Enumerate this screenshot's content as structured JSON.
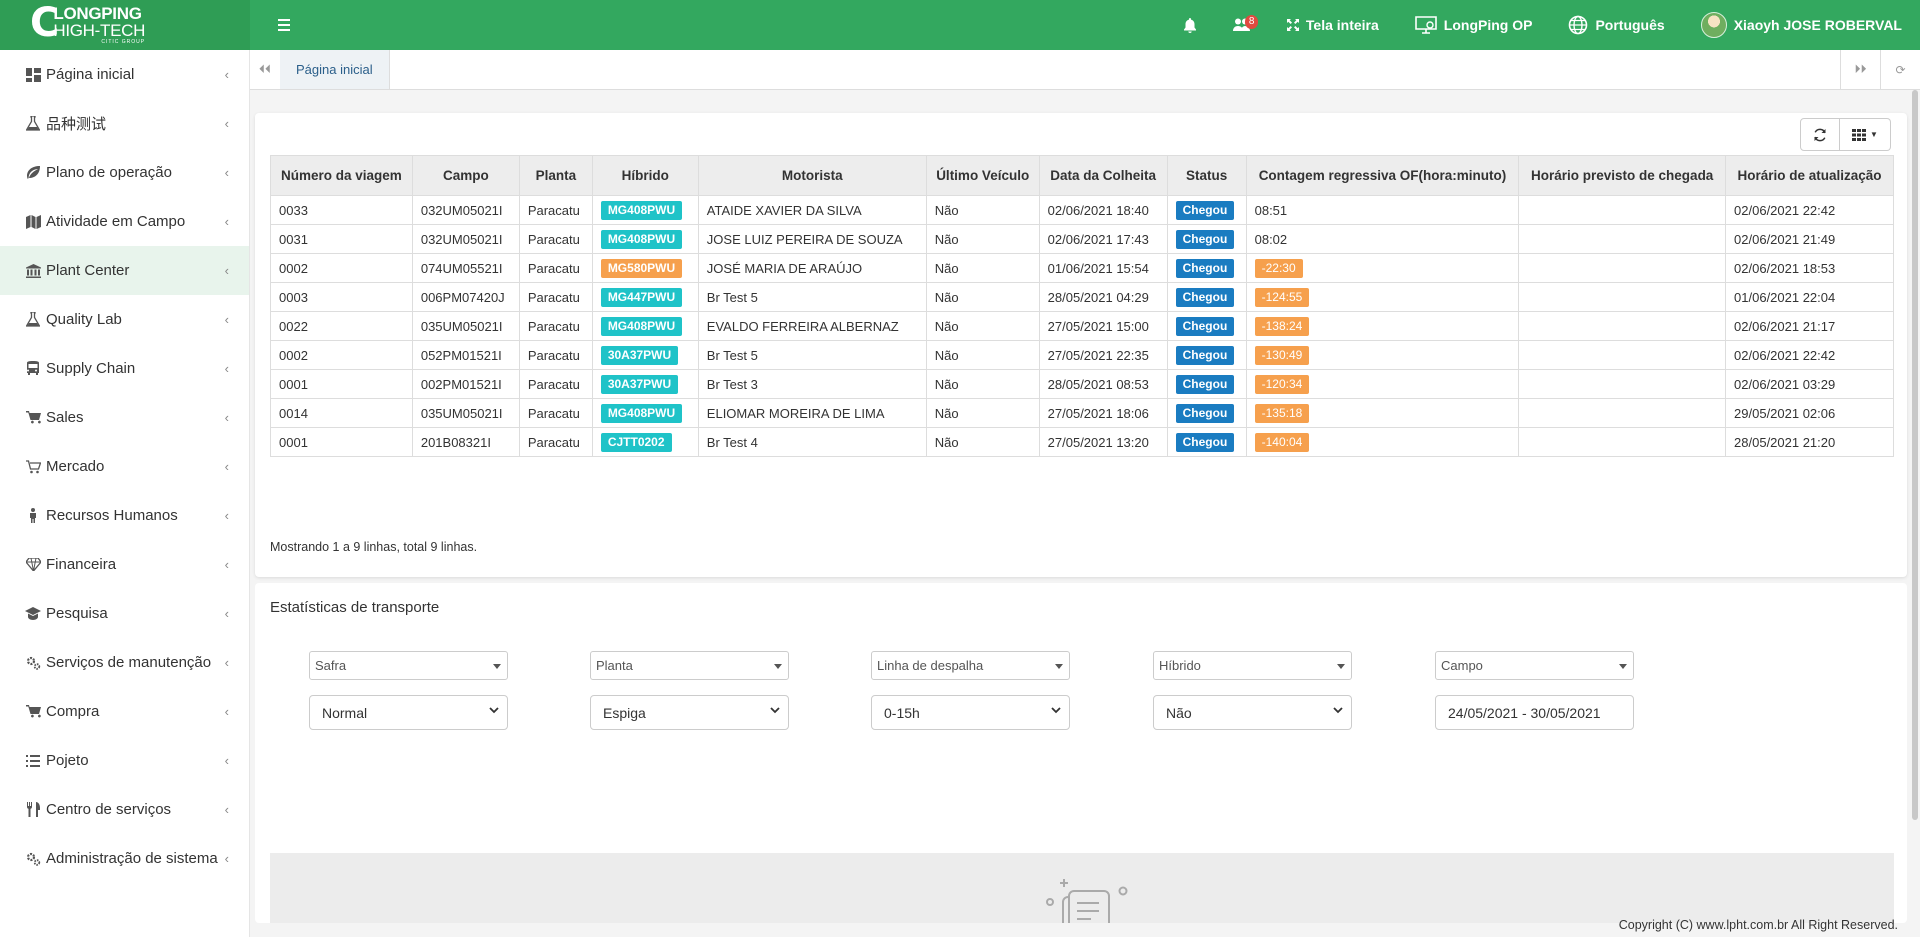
{
  "logo": {
    "line1": "LONGPING",
    "line2": "HIGH-TECH",
    "line3": "CITIC GROUP"
  },
  "topbar": {
    "notification_count": "8",
    "fullscreen_label": "Tela inteira",
    "op_label": "LongPing OP",
    "language_label": "Português",
    "user_label": "Xiaoyh JOSE ROBERVAL"
  },
  "sidebar": {
    "items": [
      {
        "label": "Página inicial",
        "icon": "dashboard-icon"
      },
      {
        "label": "品种测试",
        "icon": "flask-icon"
      },
      {
        "label": "Plano de operação",
        "icon": "leaf-icon"
      },
      {
        "label": "Atividade em Campo",
        "icon": "map-icon"
      },
      {
        "label": "Plant Center",
        "icon": "institution-icon"
      },
      {
        "label": "Quality Lab",
        "icon": "flask-icon"
      },
      {
        "label": "Supply Chain",
        "icon": "bus-icon"
      },
      {
        "label": "Sales",
        "icon": "cart-icon"
      },
      {
        "label": "Mercado",
        "icon": "cart-outline-icon"
      },
      {
        "label": "Recursos Humanos",
        "icon": "person-icon"
      },
      {
        "label": "Financeira",
        "icon": "diamond-icon"
      },
      {
        "label": "Pesquisa",
        "icon": "graduation-cap-icon"
      },
      {
        "label": "Serviços de manutenção",
        "icon": "cogs-icon"
      },
      {
        "label": "Compra",
        "icon": "cart-plus-icon"
      },
      {
        "label": "Pojeto",
        "icon": "list-icon"
      },
      {
        "label": "Centro de serviços",
        "icon": "cutlery-icon"
      },
      {
        "label": "Administração de sistema",
        "icon": "cogs-icon"
      }
    ]
  },
  "tabs": [
    {
      "label": "Página inicial"
    }
  ],
  "table": {
    "headers": [
      "Número da viagem",
      "Campo",
      "Planta",
      "Híbrido",
      "Motorista",
      "Último Veículo",
      "Data da Colheita",
      "Status",
      "Contagem regressiva OF(hora:minuto)",
      "Horário previsto de chegada",
      "Horário de atualização"
    ],
    "rows": [
      {
        "viagem": "0033",
        "campo": "032UM05021I",
        "planta": "Paracatu",
        "hibrido": "MG408PWU",
        "hibrido_color": "cyan",
        "motorista": "ATAIDE XAVIER DA SILVA",
        "veiculo": "Não",
        "colheita": "02/06/2021 18:40",
        "status": "Chegou",
        "contagem": "08:51",
        "contagem_tag": false,
        "previsto": "",
        "atualizacao": "02/06/2021 22:42"
      },
      {
        "viagem": "0031",
        "campo": "032UM05021I",
        "planta": "Paracatu",
        "hibrido": "MG408PWU",
        "hibrido_color": "cyan",
        "motorista": "JOSE LUIZ PEREIRA DE SOUZA",
        "veiculo": "Não",
        "colheita": "02/06/2021 17:43",
        "status": "Chegou",
        "contagem": "08:02",
        "contagem_tag": false,
        "previsto": "",
        "atualizacao": "02/06/2021 21:49"
      },
      {
        "viagem": "0002",
        "campo": "074UM05521I",
        "planta": "Paracatu",
        "hibrido": "MG580PWU",
        "hibrido_color": "orange",
        "motorista": "JOSÉ MARIA DE ARAÚJO",
        "veiculo": "Não",
        "colheita": "01/06/2021 15:54",
        "status": "Chegou",
        "contagem": "-22:30",
        "contagem_tag": true,
        "previsto": "",
        "atualizacao": "02/06/2021 18:53"
      },
      {
        "viagem": "0003",
        "campo": "006PM07420J",
        "planta": "Paracatu",
        "hibrido": "MG447PWU",
        "hibrido_color": "cyan",
        "motorista": "Br Test 5",
        "veiculo": "Não",
        "colheita": "28/05/2021 04:29",
        "status": "Chegou",
        "contagem": "-124:55",
        "contagem_tag": true,
        "previsto": "",
        "atualizacao": "01/06/2021 22:04"
      },
      {
        "viagem": "0022",
        "campo": "035UM05021I",
        "planta": "Paracatu",
        "hibrido": "MG408PWU",
        "hibrido_color": "cyan",
        "motorista": "EVALDO FERREIRA ALBERNAZ",
        "veiculo": "Não",
        "colheita": "27/05/2021 15:00",
        "status": "Chegou",
        "contagem": "-138:24",
        "contagem_tag": true,
        "previsto": "",
        "atualizacao": "02/06/2021 21:17"
      },
      {
        "viagem": "0002",
        "campo": "052PM01521I",
        "planta": "Paracatu",
        "hibrido": "30A37PWU",
        "hibrido_color": "cyan",
        "motorista": "Br Test 5",
        "veiculo": "Não",
        "colheita": "27/05/2021 22:35",
        "status": "Chegou",
        "contagem": "-130:49",
        "contagem_tag": true,
        "previsto": "",
        "atualizacao": "02/06/2021 22:42"
      },
      {
        "viagem": "0001",
        "campo": "002PM01521I",
        "planta": "Paracatu",
        "hibrido": "30A37PWU",
        "hibrido_color": "cyan",
        "motorista": "Br Test 3",
        "veiculo": "Não",
        "colheita": "28/05/2021 08:53",
        "status": "Chegou",
        "contagem": "-120:34",
        "contagem_tag": true,
        "previsto": "",
        "atualizacao": "02/06/2021 03:29"
      },
      {
        "viagem": "0014",
        "campo": "035UM05021I",
        "planta": "Paracatu",
        "hibrido": "MG408PWU",
        "hibrido_color": "cyan",
        "motorista": "ELIOMAR MOREIRA DE LIMA",
        "veiculo": "Não",
        "colheita": "27/05/2021 18:06",
        "status": "Chegou",
        "contagem": "-135:18",
        "contagem_tag": true,
        "previsto": "",
        "atualizacao": "29/05/2021 02:06"
      },
      {
        "viagem": "0001",
        "campo": "201B08321I",
        "planta": "Paracatu",
        "hibrido": "CJTT0202",
        "hibrido_color": "cyan",
        "motorista": "Br Test 4",
        "veiculo": "Não",
        "colheita": "27/05/2021 13:20",
        "status": "Chegou",
        "contagem": "-140:04",
        "contagem_tag": true,
        "previsto": "",
        "atualizacao": "28/05/2021 21:20"
      }
    ],
    "footer": "Mostrando 1 a 9 linhas, total 9 linhas."
  },
  "stats": {
    "title": "Estatísticas de transporte",
    "filters_top": [
      {
        "placeholder": "Safra"
      },
      {
        "placeholder": "Planta"
      },
      {
        "placeholder": "Linha de despalha"
      },
      {
        "placeholder": "Híbrido"
      },
      {
        "placeholder": "Campo"
      }
    ],
    "filters_bottom": [
      {
        "value": "Normal"
      },
      {
        "value": "Espiga"
      },
      {
        "value": "0-15h"
      },
      {
        "value": "Não"
      },
      {
        "value": "24/05/2021 - 30/05/2021"
      }
    ]
  },
  "copyright": "Copyright (C) www.lpht.com.br All Right Reserved.",
  "colors": {
    "primary": "#33a85f",
    "cyan": "#1fc3c8",
    "orange": "#f6a04d",
    "blue": "#1a7cc1"
  }
}
